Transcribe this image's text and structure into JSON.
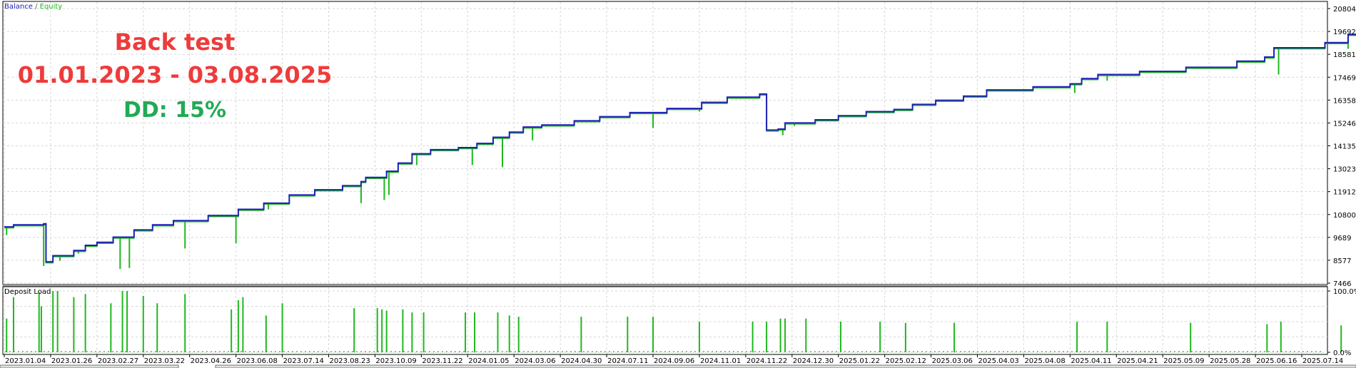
{
  "legend": {
    "balance_label": "Balance",
    "separator": " / ",
    "equity_label": "Equity",
    "balance_color": "#1f1fb8",
    "equity_color": "#1fb81f"
  },
  "overlay": {
    "line1": "Back test",
    "line2": "01.01.2023 - 03.08.2025",
    "line3": "DD: 15%",
    "line1_color": "#ee3b3b",
    "line2_color": "#ee3b3b",
    "line3_color": "#22aa55"
  },
  "panel2": {
    "title": "Deposit Load"
  },
  "chart_data": [
    {
      "type": "line",
      "title": "",
      "legend": [
        "Balance",
        "Equity"
      ],
      "ylim": [
        7466,
        20804
      ],
      "y_ticks": [
        "20804",
        "19692",
        "18581",
        "17469",
        "16358",
        "15246",
        "14135",
        "13023",
        "11912",
        "10800",
        "9689",
        "8577",
        "7466"
      ],
      "grid": true,
      "x": [
        "2023.01.04",
        "2023.01.26",
        "2023.02.27",
        "2023.03.22",
        "2023.04.26",
        "2023.06.08",
        "2023.07.14",
        "2023.08.23",
        "2023.10.09",
        "2023.11.22",
        "2024.01.05",
        "2024.03.06",
        "2024.04.30",
        "2024.07.11",
        "2024.09.06",
        "2024.11.01",
        "2024.11.22",
        "2024.12.30",
        "2025.01.22",
        "2025.02.12",
        "2025.03.06",
        "2025.04.03",
        "2025.04.08",
        "2025.04.11",
        "2025.04.21",
        "2025.05.09",
        "2025.05.28",
        "2025.06.16",
        "2025.07.14"
      ],
      "series": [
        {
          "name": "Balance",
          "values": [
            [
              0,
              10200
            ],
            [
              0.2,
              10300
            ],
            [
              0.85,
              10350
            ],
            [
              0.9,
              8500
            ],
            [
              1.05,
              8800
            ],
            [
              1.5,
              9050
            ],
            [
              1.75,
              9300
            ],
            [
              2.0,
              9450
            ],
            [
              2.35,
              9700
            ],
            [
              2.8,
              10050
            ],
            [
              3.2,
              10300
            ],
            [
              3.65,
              10500
            ],
            [
              4.4,
              10750
            ],
            [
              5.05,
              11050
            ],
            [
              5.6,
              11350
            ],
            [
              6.15,
              11750
            ],
            [
              6.7,
              12000
            ],
            [
              7.3,
              12200
            ],
            [
              7.7,
              12400
            ],
            [
              7.8,
              12600
            ],
            [
              8.25,
              12900
            ],
            [
              8.5,
              13300
            ],
            [
              8.8,
              13750
            ],
            [
              9.2,
              13950
            ],
            [
              9.8,
              14050
            ],
            [
              10.2,
              14250
            ],
            [
              10.55,
              14550
            ],
            [
              10.9,
              14800
            ],
            [
              11.2,
              15050
            ],
            [
              11.6,
              15150
            ],
            [
              12.3,
              15350
            ],
            [
              12.85,
              15550
            ],
            [
              13.5,
              15750
            ],
            [
              14.3,
              15950
            ],
            [
              15.05,
              16250
            ],
            [
              15.6,
              16500
            ],
            [
              16.3,
              16650
            ],
            [
              16.45,
              14900
            ],
            [
              16.7,
              14950
            ],
            [
              16.85,
              15250
            ],
            [
              17.5,
              15400
            ],
            [
              18.0,
              15600
            ],
            [
              18.6,
              15800
            ],
            [
              19.2,
              15900
            ],
            [
              19.6,
              16150
            ],
            [
              20.1,
              16350
            ],
            [
              20.7,
              16550
            ],
            [
              21.2,
              16850
            ],
            [
              22.2,
              17000
            ],
            [
              23.0,
              17150
            ],
            [
              23.25,
              17400
            ],
            [
              23.6,
              17600
            ],
            [
              24.5,
              17750
            ],
            [
              25.5,
              17950
            ],
            [
              26.6,
              18250
            ],
            [
              27.2,
              18450
            ],
            [
              27.4,
              18900
            ],
            [
              28.5,
              19150
            ],
            [
              29.0,
              19550
            ],
            [
              29.25,
              19650
            ]
          ]
        },
        {
          "name": "Equity",
          "values": [
            [
              0.05,
              9800
            ],
            [
              0.85,
              8300
            ],
            [
              1.2,
              8550
            ],
            [
              1.6,
              8900
            ],
            [
              2.5,
              8150
            ],
            [
              2.7,
              8200
            ],
            [
              3.9,
              9150
            ],
            [
              5.0,
              9400
            ],
            [
              5.7,
              11050
            ],
            [
              7.7,
              11350
            ],
            [
              8.2,
              11500
            ],
            [
              8.3,
              11750
            ],
            [
              8.9,
              13200
            ],
            [
              10.1,
              13200
            ],
            [
              10.75,
              13100
            ],
            [
              11.4,
              14400
            ],
            [
              14.0,
              15000
            ],
            [
              15.0,
              15800
            ],
            [
              16.8,
              14650
            ],
            [
              17.05,
              15100
            ],
            [
              23.1,
              16700
            ],
            [
              23.8,
              17300
            ],
            [
              27.5,
              17600
            ],
            [
              29.0,
              18850
            ]
          ]
        }
      ]
    },
    {
      "type": "bar",
      "title": "Deposit Load",
      "ylim": [
        0,
        100
      ],
      "y_ticks": [
        "100.0%",
        "0.0%"
      ],
      "grid": true,
      "series": [
        {
          "name": "",
          "values": [
            [
              0.05,
              55
            ],
            [
              0.2,
              90
            ],
            [
              0.75,
              98
            ],
            [
              0.8,
              75
            ],
            [
              1.05,
              100
            ],
            [
              1.15,
              100
            ],
            [
              1.5,
              90
            ],
            [
              1.75,
              95
            ],
            [
              2.3,
              80
            ],
            [
              2.55,
              100
            ],
            [
              2.65,
              100
            ],
            [
              3.0,
              92
            ],
            [
              3.3,
              80
            ],
            [
              3.9,
              95
            ],
            [
              4.9,
              70
            ],
            [
              5.05,
              85
            ],
            [
              5.15,
              90
            ],
            [
              5.65,
              60
            ],
            [
              6.0,
              80
            ],
            [
              7.55,
              72
            ],
            [
              8.05,
              72
            ],
            [
              8.15,
              70
            ],
            [
              8.25,
              68
            ],
            [
              8.6,
              70
            ],
            [
              8.8,
              65
            ],
            [
              9.05,
              65
            ],
            [
              9.95,
              65
            ],
            [
              10.15,
              65
            ],
            [
              10.65,
              65
            ],
            [
              10.9,
              60
            ],
            [
              11.1,
              58
            ],
            [
              12.45,
              58
            ],
            [
              13.45,
              58
            ],
            [
              14.0,
              58
            ],
            [
              15.0,
              50
            ],
            [
              16.15,
              50
            ],
            [
              16.45,
              50
            ],
            [
              16.75,
              55
            ],
            [
              16.85,
              55
            ],
            [
              17.3,
              55
            ],
            [
              18.05,
              50
            ],
            [
              18.9,
              50
            ],
            [
              19.45,
              48
            ],
            [
              20.5,
              48
            ],
            [
              23.15,
              50
            ],
            [
              23.8,
              50
            ],
            [
              25.6,
              48
            ],
            [
              27.25,
              46
            ],
            [
              27.55,
              50
            ],
            [
              28.85,
              44
            ],
            [
              29.25,
              46
            ]
          ]
        }
      ]
    }
  ]
}
